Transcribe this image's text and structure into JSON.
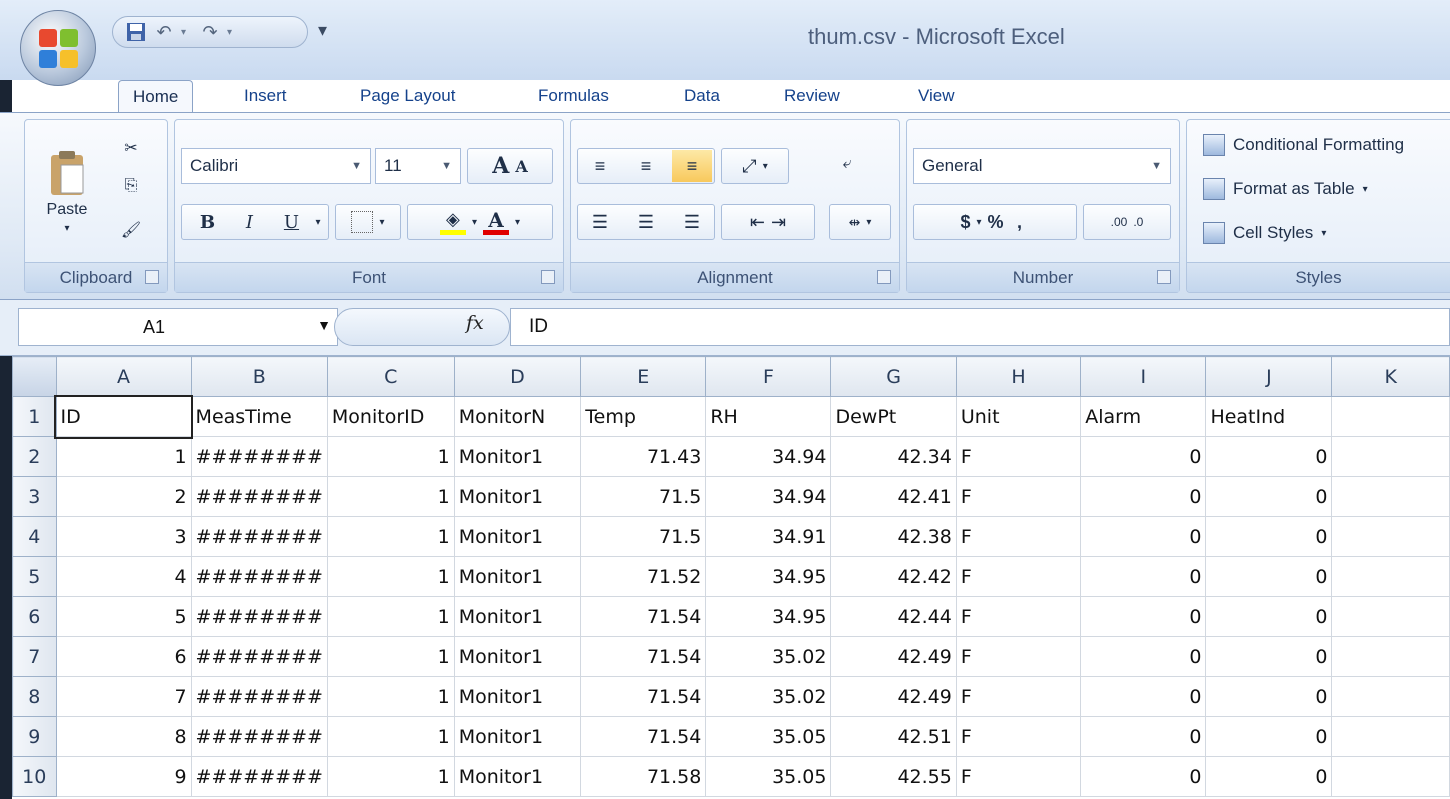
{
  "title": "thum.csv - Microsoft Excel",
  "tabs": [
    {
      "label": "Home"
    },
    {
      "label": "Insert"
    },
    {
      "label": "Page Layout"
    },
    {
      "label": "Formulas"
    },
    {
      "label": "Data"
    },
    {
      "label": "Review"
    },
    {
      "label": "View"
    }
  ],
  "ribbon": {
    "clipboard": {
      "label": "Clipboard",
      "paste": "Paste"
    },
    "font": {
      "label": "Font",
      "name": "Calibri",
      "size": "11",
      "bold": "B",
      "italic": "I",
      "underline": "U",
      "grow": "A",
      "shrink": "A",
      "color": "A"
    },
    "alignment": {
      "label": "Alignment"
    },
    "number": {
      "label": "Number",
      "format": "General",
      "currency": "$",
      "percent": "%",
      "comma": ",",
      "inc_decimal": ".00",
      "dec_decimal": ".0"
    },
    "styles": {
      "label": "Styles",
      "conditional": "Conditional Formatting",
      "format_table": "Format as Table",
      "cell_styles": "Cell Styles"
    }
  },
  "formula_bar": {
    "name_box": "A1",
    "fx": "fx",
    "value": "ID"
  },
  "sheet": {
    "columns": [
      "A",
      "B",
      "C",
      "D",
      "E",
      "F",
      "G",
      "H",
      "I",
      "J",
      "K"
    ],
    "rows": [
      {
        "num": "1",
        "cells": [
          "ID",
          "MeasTime",
          "MonitorID",
          "MonitorN",
          "Temp",
          "RH",
          "DewPt",
          "Unit",
          "Alarm",
          "HeatInd",
          ""
        ]
      },
      {
        "num": "2",
        "cells": [
          "1",
          "########",
          "1",
          "Monitor1",
          "71.43",
          "34.94",
          "42.34",
          "F",
          "0",
          "0",
          ""
        ]
      },
      {
        "num": "3",
        "cells": [
          "2",
          "########",
          "1",
          "Monitor1",
          "71.5",
          "34.94",
          "42.41",
          "F",
          "0",
          "0",
          ""
        ]
      },
      {
        "num": "4",
        "cells": [
          "3",
          "########",
          "1",
          "Monitor1",
          "71.5",
          "34.91",
          "42.38",
          "F",
          "0",
          "0",
          ""
        ]
      },
      {
        "num": "5",
        "cells": [
          "4",
          "########",
          "1",
          "Monitor1",
          "71.52",
          "34.95",
          "42.42",
          "F",
          "0",
          "0",
          ""
        ]
      },
      {
        "num": "6",
        "cells": [
          "5",
          "########",
          "1",
          "Monitor1",
          "71.54",
          "34.95",
          "42.44",
          "F",
          "0",
          "0",
          ""
        ]
      },
      {
        "num": "7",
        "cells": [
          "6",
          "########",
          "1",
          "Monitor1",
          "71.54",
          "35.02",
          "42.49",
          "F",
          "0",
          "0",
          ""
        ]
      },
      {
        "num": "8",
        "cells": [
          "7",
          "########",
          "1",
          "Monitor1",
          "71.54",
          "35.02",
          "42.49",
          "F",
          "0",
          "0",
          ""
        ]
      },
      {
        "num": "9",
        "cells": [
          "8",
          "########",
          "1",
          "Monitor1",
          "71.54",
          "35.05",
          "42.51",
          "F",
          "0",
          "0",
          ""
        ]
      },
      {
        "num": "10",
        "cells": [
          "9",
          "########",
          "1",
          "Monitor1",
          "71.58",
          "35.05",
          "42.55",
          "F",
          "0",
          "0",
          ""
        ]
      }
    ]
  }
}
